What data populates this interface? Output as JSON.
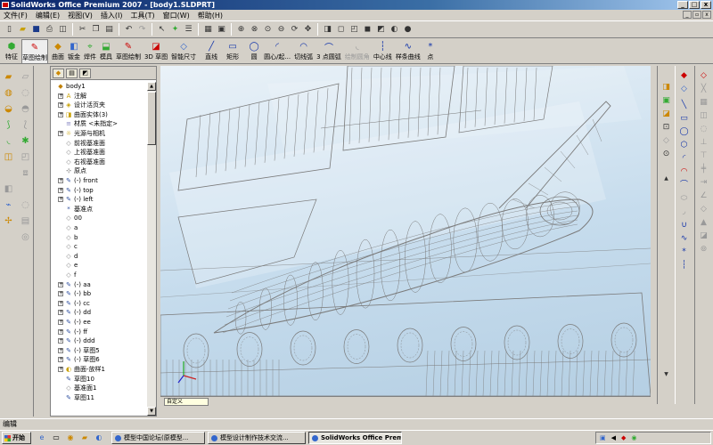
{
  "app": {
    "title": "SolidWorks Office Premium 2007 - [body1.SLDPRT]"
  },
  "menu": [
    "文件(F)",
    "编辑(E)",
    "视图(V)",
    "插入(I)",
    "工具(T)",
    "窗口(W)",
    "帮助(H)"
  ],
  "toolbar_icons": [
    "new-icon",
    "open-icon",
    "save-icon",
    "print-icon",
    "print-preview-icon",
    "cut-icon",
    "copy-icon",
    "paste-icon",
    "undo-icon",
    "redo-icon",
    "select-icon",
    "rebuild-icon",
    "options-icon",
    "grid-icon",
    "zoom-fit-icon",
    "zoom-area-icon",
    "zoom-in-icon",
    "rotate-icon",
    "pan-icon",
    "view-orient-icon",
    "wireframe-icon",
    "hidden-lines-icon",
    "shaded-icon",
    "section-view-icon",
    "light-icon",
    "camera-icon"
  ],
  "command_manager": {
    "items": [
      {
        "label": "特征",
        "icon": "features-icon"
      },
      {
        "label": "草图绘制",
        "icon": "sketch-icon",
        "active": true
      },
      {
        "label": "曲面",
        "icon": "surfaces-icon"
      },
      {
        "label": "钣金",
        "icon": "sheetmetal-icon"
      },
      {
        "label": "焊件",
        "icon": "weldments-icon"
      },
      {
        "label": "模具",
        "icon": "mold-icon"
      },
      {
        "label": "草图绘制",
        "icon": "sketch-draw-icon"
      },
      {
        "label": "3D 草图",
        "icon": "3d-sketch-icon"
      },
      {
        "label": "智能尺寸",
        "icon": "smart-dimension-icon"
      },
      {
        "label": "直线",
        "icon": "line-icon"
      },
      {
        "label": "矩形",
        "icon": "rectangle-icon"
      },
      {
        "label": "圆",
        "icon": "circle-icon"
      },
      {
        "label": "圆心/起...",
        "icon": "centerpoint-arc-icon"
      },
      {
        "label": "切线弧",
        "icon": "tangent-arc-icon"
      },
      {
        "label": "3 点圆弧",
        "icon": "three-point-arc-icon"
      },
      {
        "label": "绘制圆角",
        "icon": "sketch-fillet-icon"
      },
      {
        "label": "中心线",
        "icon": "centerline-icon"
      },
      {
        "label": "样条曲线",
        "icon": "spline-icon"
      },
      {
        "label": "点",
        "icon": "point-icon"
      }
    ]
  },
  "feature_tree": {
    "items": [
      {
        "label": "body1",
        "indent": 0,
        "expand": "",
        "icon": "part-icon",
        "color": "#c08000"
      },
      {
        "label": "注解",
        "indent": 1,
        "expand": "+",
        "icon": "annotations-icon",
        "color": "#c8a000"
      },
      {
        "label": "设计活页夹",
        "indent": 1,
        "expand": "+",
        "icon": "design-binder-icon",
        "color": "#c8a000"
      },
      {
        "label": "曲面实体(3)",
        "indent": 1,
        "expand": "+",
        "icon": "surface-bodies-icon",
        "color": "#c8a000"
      },
      {
        "label": "材质 <未指定>",
        "indent": 1,
        "expand": "",
        "icon": "material-icon",
        "color": "#8080c0"
      },
      {
        "label": "光源与相机",
        "indent": 1,
        "expand": "+",
        "icon": "lights-icon",
        "color": "#c8a000"
      },
      {
        "label": "前视基准面",
        "indent": 1,
        "expand": "",
        "icon": "plane-icon",
        "color": "#808080"
      },
      {
        "label": "上视基准面",
        "indent": 1,
        "expand": "",
        "icon": "plane-icon",
        "color": "#808080"
      },
      {
        "label": "右视基准面",
        "indent": 1,
        "expand": "",
        "icon": "plane-icon",
        "color": "#808080"
      },
      {
        "label": "原点",
        "indent": 1,
        "expand": "",
        "icon": "origin-icon",
        "color": "#404040"
      },
      {
        "label": "(-) front",
        "indent": 1,
        "expand": "+",
        "icon": "sketch-icon",
        "color": "#3050a0"
      },
      {
        "label": "(-) top",
        "indent": 1,
        "expand": "+",
        "icon": "sketch-icon",
        "color": "#3050a0"
      },
      {
        "label": "(-) left",
        "indent": 1,
        "expand": "+",
        "icon": "sketch-icon",
        "color": "#3050a0"
      },
      {
        "label": "基准点",
        "indent": 1,
        "expand": "",
        "icon": "reference-point-icon",
        "color": "#3050a0"
      },
      {
        "label": "00",
        "indent": 1,
        "expand": "",
        "icon": "plane-icon",
        "color": "#808080"
      },
      {
        "label": "a",
        "indent": 1,
        "expand": "",
        "icon": "plane-icon",
        "color": "#808080"
      },
      {
        "label": "b",
        "indent": 1,
        "expand": "",
        "icon": "plane-icon",
        "color": "#808080"
      },
      {
        "label": "c",
        "indent": 1,
        "expand": "",
        "icon": "plane-icon",
        "color": "#808080"
      },
      {
        "label": "d",
        "indent": 1,
        "expand": "",
        "icon": "plane-icon",
        "color": "#808080"
      },
      {
        "label": "e",
        "indent": 1,
        "expand": "",
        "icon": "plane-icon",
        "color": "#808080"
      },
      {
        "label": "f",
        "indent": 1,
        "expand": "",
        "icon": "plane-icon",
        "color": "#808080"
      },
      {
        "label": "(-) aa",
        "indent": 1,
        "expand": "+",
        "icon": "sketch-icon",
        "color": "#3050a0"
      },
      {
        "label": "(-) bb",
        "indent": 1,
        "expand": "+",
        "icon": "sketch-icon",
        "color": "#3050a0"
      },
      {
        "label": "(-) cc",
        "indent": 1,
        "expand": "+",
        "icon": "sketch-icon",
        "color": "#3050a0"
      },
      {
        "label": "(-) dd",
        "indent": 1,
        "expand": "+",
        "icon": "sketch-icon",
        "color": "#3050a0"
      },
      {
        "label": "(-) ee",
        "indent": 1,
        "expand": "+",
        "icon": "sketch-icon",
        "color": "#3050a0"
      },
      {
        "label": "(-) ff",
        "indent": 1,
        "expand": "+",
        "icon": "sketch-icon",
        "color": "#3050a0"
      },
      {
        "label": "(-) ddd",
        "indent": 1,
        "expand": "+",
        "icon": "sketch-icon",
        "color": "#3050a0"
      },
      {
        "label": "(-) 草图5",
        "indent": 1,
        "expand": "+",
        "icon": "sketch-icon",
        "color": "#3050a0"
      },
      {
        "label": "(-) 草图6",
        "indent": 1,
        "expand": "+",
        "icon": "sketch-icon",
        "color": "#3050a0"
      },
      {
        "label": "曲面-放样1",
        "indent": 1,
        "expand": "+",
        "icon": "loft-surface-icon",
        "color": "#c8a000"
      },
      {
        "label": "草图10",
        "indent": 1,
        "expand": "",
        "icon": "sketch-icon",
        "color": "#3050a0"
      },
      {
        "label": "基准面1",
        "indent": 1,
        "expand": "",
        "icon": "plane-icon",
        "color": "#808080"
      },
      {
        "label": "草图11",
        "indent": 1,
        "expand": "",
        "icon": "sketch-icon",
        "color": "#3050a0"
      }
    ]
  },
  "viewport": {
    "sheet_tab": "自定义",
    "background_top": "#eaf2f8",
    "background_bottom": "#b5cfe3",
    "line_color": "#7a7a7a"
  },
  "status": {
    "text": "编辑"
  },
  "taskbar": {
    "start": "开始",
    "tasks": [
      {
        "label": "模型中国论坛(原模型...",
        "active": false
      },
      {
        "label": "模型设计制作技术交流...",
        "active": false
      },
      {
        "label": "SolidWorks Office Premiu...",
        "active": true
      }
    ],
    "tray_icons": [
      "network-icon",
      "volume-icon",
      "input-method-icon",
      "security-icon"
    ]
  }
}
